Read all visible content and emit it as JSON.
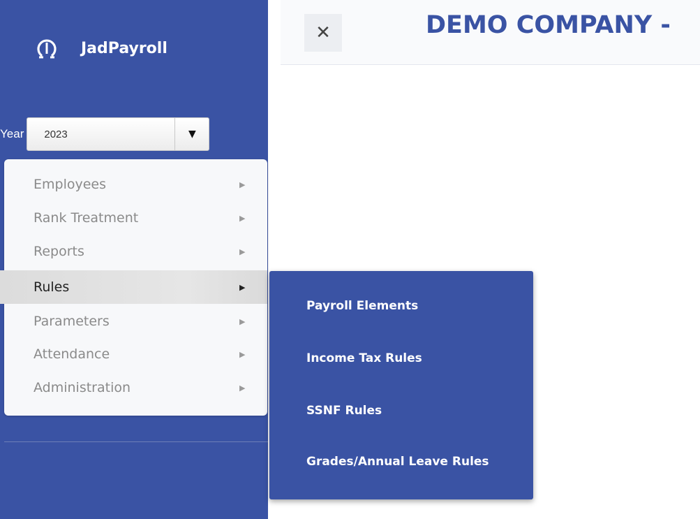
{
  "app": {
    "name": "JadPayroll",
    "company_title": "DEMO COMPANY -"
  },
  "icons": {
    "logo": "gauge-icon",
    "close": "close-icon",
    "dropdown": "caret-down-icon",
    "submenu_arrow": "caret-right-icon"
  },
  "colors": {
    "brand": "#3a53a4",
    "menu_bg": "#f7f8fa",
    "menu_text": "#8a8a8a",
    "active_bg": "#dcdcdc"
  },
  "year": {
    "label": "Year",
    "value": "2023"
  },
  "topbar": {
    "close_glyph": "✕"
  },
  "menu": {
    "items": [
      {
        "label": "Employees",
        "arrow": "▶"
      },
      {
        "label": "Rank Treatment",
        "arrow": "▶"
      },
      {
        "label": "Reports",
        "arrow": "▶"
      },
      {
        "label": "Rules",
        "arrow": "▶"
      },
      {
        "label": "Parameters",
        "arrow": "▶"
      },
      {
        "label": "Attendance",
        "arrow": "▶"
      },
      {
        "label": "Administration",
        "arrow": "▶"
      }
    ],
    "active_index": 3
  },
  "submenu": {
    "items": [
      {
        "label": "Payroll Elements"
      },
      {
        "label": "Income Tax Rules"
      },
      {
        "label": "SSNF Rules"
      },
      {
        "label": "Grades/Annual Leave Rules"
      }
    ]
  }
}
